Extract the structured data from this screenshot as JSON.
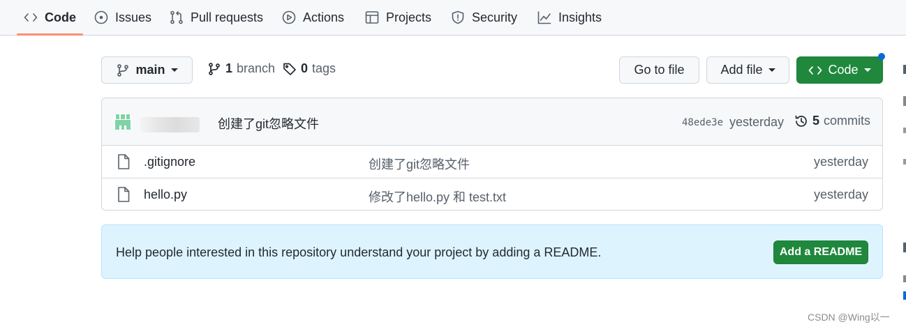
{
  "nav": {
    "tabs": [
      {
        "label": "Code",
        "icon": "code-icon",
        "active": true
      },
      {
        "label": "Issues",
        "icon": "issue-icon"
      },
      {
        "label": "Pull requests",
        "icon": "pull-request-icon"
      },
      {
        "label": "Actions",
        "icon": "play-icon"
      },
      {
        "label": "Projects",
        "icon": "table-icon"
      },
      {
        "label": "Security",
        "icon": "shield-icon"
      },
      {
        "label": "Insights",
        "icon": "graph-icon"
      }
    ]
  },
  "branch_bar": {
    "branch_label": "main",
    "branch_count": "1",
    "branch_word": "branch",
    "tag_count": "0",
    "tag_word": "tags",
    "go_to_file_label": "Go to file",
    "add_file_label": "Add file",
    "code_button_label": "Code"
  },
  "latest_commit": {
    "message": "创建了git忽略文件",
    "sha": "48ede3e",
    "when": "yesterday",
    "commit_count": "5",
    "commit_word": "commits"
  },
  "files": [
    {
      "name": ".gitignore",
      "message": "创建了git忽略文件",
      "age": "yesterday"
    },
    {
      "name": "hello.py",
      "message": "修改了hello.py 和 test.txt",
      "age": "yesterday"
    }
  ],
  "readme_prompt": {
    "text": "Help people interested in this repository understand your project by adding a README.",
    "button_label": "Add a README"
  },
  "watermark": "CSDN @Wing以一",
  "colors": {
    "accent_green": "#1f883d",
    "active_tab_underline": "#fd8c73",
    "readme_bg": "#ddf4ff",
    "notification_dot": "#0969da"
  }
}
